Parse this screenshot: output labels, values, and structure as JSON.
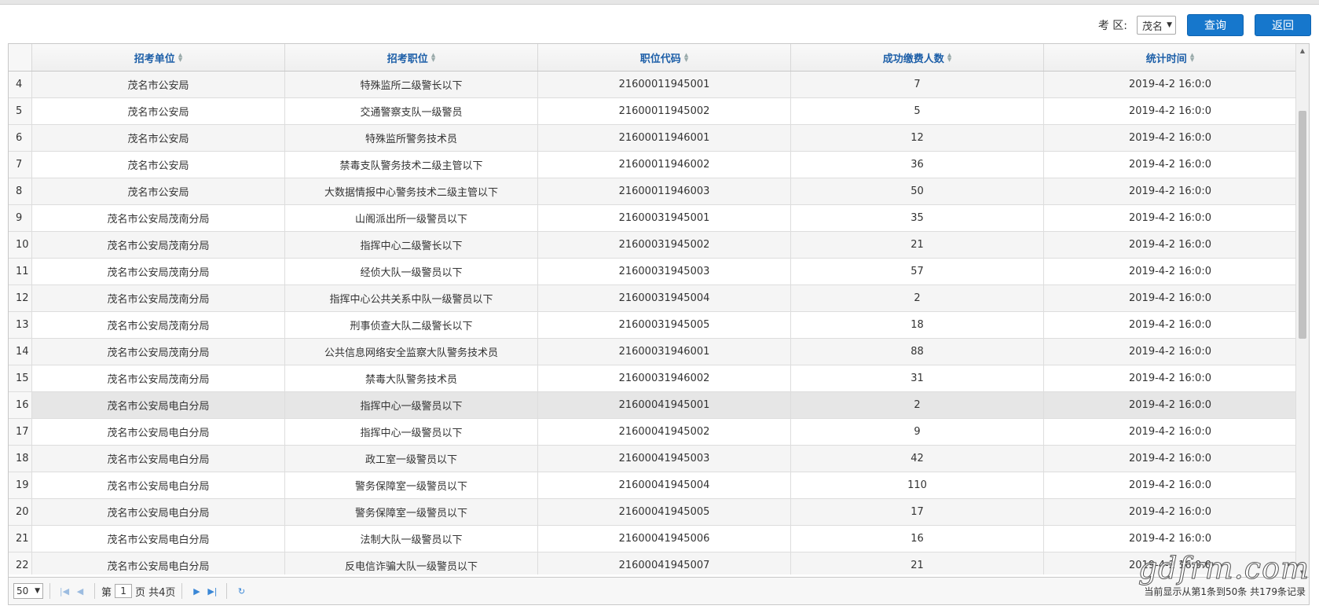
{
  "toolbar": {
    "region_label": "考 区:",
    "region_value": "茂名",
    "query_label": "查询",
    "back_label": "返回"
  },
  "table": {
    "columns": [
      "招考单位",
      "招考职位",
      "职位代码",
      "成功缴费人数",
      "统计时间"
    ],
    "rows": [
      {
        "n": "4",
        "unit": "茂名市公安局",
        "pos": "特殊监所二级警长以下",
        "code": "21600011945001",
        "count": "7",
        "time": "2019-4-2 16:0:0"
      },
      {
        "n": "5",
        "unit": "茂名市公安局",
        "pos": "交通警察支队一级警员",
        "code": "21600011945002",
        "count": "5",
        "time": "2019-4-2 16:0:0"
      },
      {
        "n": "6",
        "unit": "茂名市公安局",
        "pos": "特殊监所警务技术员",
        "code": "21600011946001",
        "count": "12",
        "time": "2019-4-2 16:0:0"
      },
      {
        "n": "7",
        "unit": "茂名市公安局",
        "pos": "禁毒支队警务技术二级主管以下",
        "code": "21600011946002",
        "count": "36",
        "time": "2019-4-2 16:0:0"
      },
      {
        "n": "8",
        "unit": "茂名市公安局",
        "pos": "大数据情报中心警务技术二级主管以下",
        "code": "21600011946003",
        "count": "50",
        "time": "2019-4-2 16:0:0"
      },
      {
        "n": "9",
        "unit": "茂名市公安局茂南分局",
        "pos": "山阁派出所一级警员以下",
        "code": "21600031945001",
        "count": "35",
        "time": "2019-4-2 16:0:0"
      },
      {
        "n": "10",
        "unit": "茂名市公安局茂南分局",
        "pos": "指挥中心二级警长以下",
        "code": "21600031945002",
        "count": "21",
        "time": "2019-4-2 16:0:0"
      },
      {
        "n": "11",
        "unit": "茂名市公安局茂南分局",
        "pos": "经侦大队一级警员以下",
        "code": "21600031945003",
        "count": "57",
        "time": "2019-4-2 16:0:0"
      },
      {
        "n": "12",
        "unit": "茂名市公安局茂南分局",
        "pos": "指挥中心公共关系中队一级警员以下",
        "code": "21600031945004",
        "count": "2",
        "time": "2019-4-2 16:0:0"
      },
      {
        "n": "13",
        "unit": "茂名市公安局茂南分局",
        "pos": "刑事侦查大队二级警长以下",
        "code": "21600031945005",
        "count": "18",
        "time": "2019-4-2 16:0:0"
      },
      {
        "n": "14",
        "unit": "茂名市公安局茂南分局",
        "pos": "公共信息网络安全监察大队警务技术员",
        "code": "21600031946001",
        "count": "88",
        "time": "2019-4-2 16:0:0"
      },
      {
        "n": "15",
        "unit": "茂名市公安局茂南分局",
        "pos": "禁毒大队警务技术员",
        "code": "21600031946002",
        "count": "31",
        "time": "2019-4-2 16:0:0"
      },
      {
        "n": "16",
        "unit": "茂名市公安局电白分局",
        "pos": "指挥中心一级警员以下",
        "code": "21600041945001",
        "count": "2",
        "time": "2019-4-2 16:0:0"
      },
      {
        "n": "17",
        "unit": "茂名市公安局电白分局",
        "pos": "指挥中心一级警员以下",
        "code": "21600041945002",
        "count": "9",
        "time": "2019-4-2 16:0:0"
      },
      {
        "n": "18",
        "unit": "茂名市公安局电白分局",
        "pos": "政工室一级警员以下",
        "code": "21600041945003",
        "count": "42",
        "time": "2019-4-2 16:0:0"
      },
      {
        "n": "19",
        "unit": "茂名市公安局电白分局",
        "pos": "警务保障室一级警员以下",
        "code": "21600041945004",
        "count": "110",
        "time": "2019-4-2 16:0:0"
      },
      {
        "n": "20",
        "unit": "茂名市公安局电白分局",
        "pos": "警务保障室一级警员以下",
        "code": "21600041945005",
        "count": "17",
        "time": "2019-4-2 16:0:0"
      },
      {
        "n": "21",
        "unit": "茂名市公安局电白分局",
        "pos": "法制大队一级警员以下",
        "code": "21600041945006",
        "count": "16",
        "time": "2019-4-2 16:0:0"
      },
      {
        "n": "22",
        "unit": "茂名市公安局电白分局",
        "pos": "反电信诈骗大队一级警员以下",
        "code": "21600041945007",
        "count": "21",
        "time": "2019-4-2 16:0:0"
      }
    ]
  },
  "pager": {
    "page_size": "50",
    "page_prefix": "第",
    "page_value": "1",
    "page_suffix": "页 共4页",
    "info": "当前显示从第1条到50条 共179条记录"
  },
  "watermark": "gdfrm.com"
}
